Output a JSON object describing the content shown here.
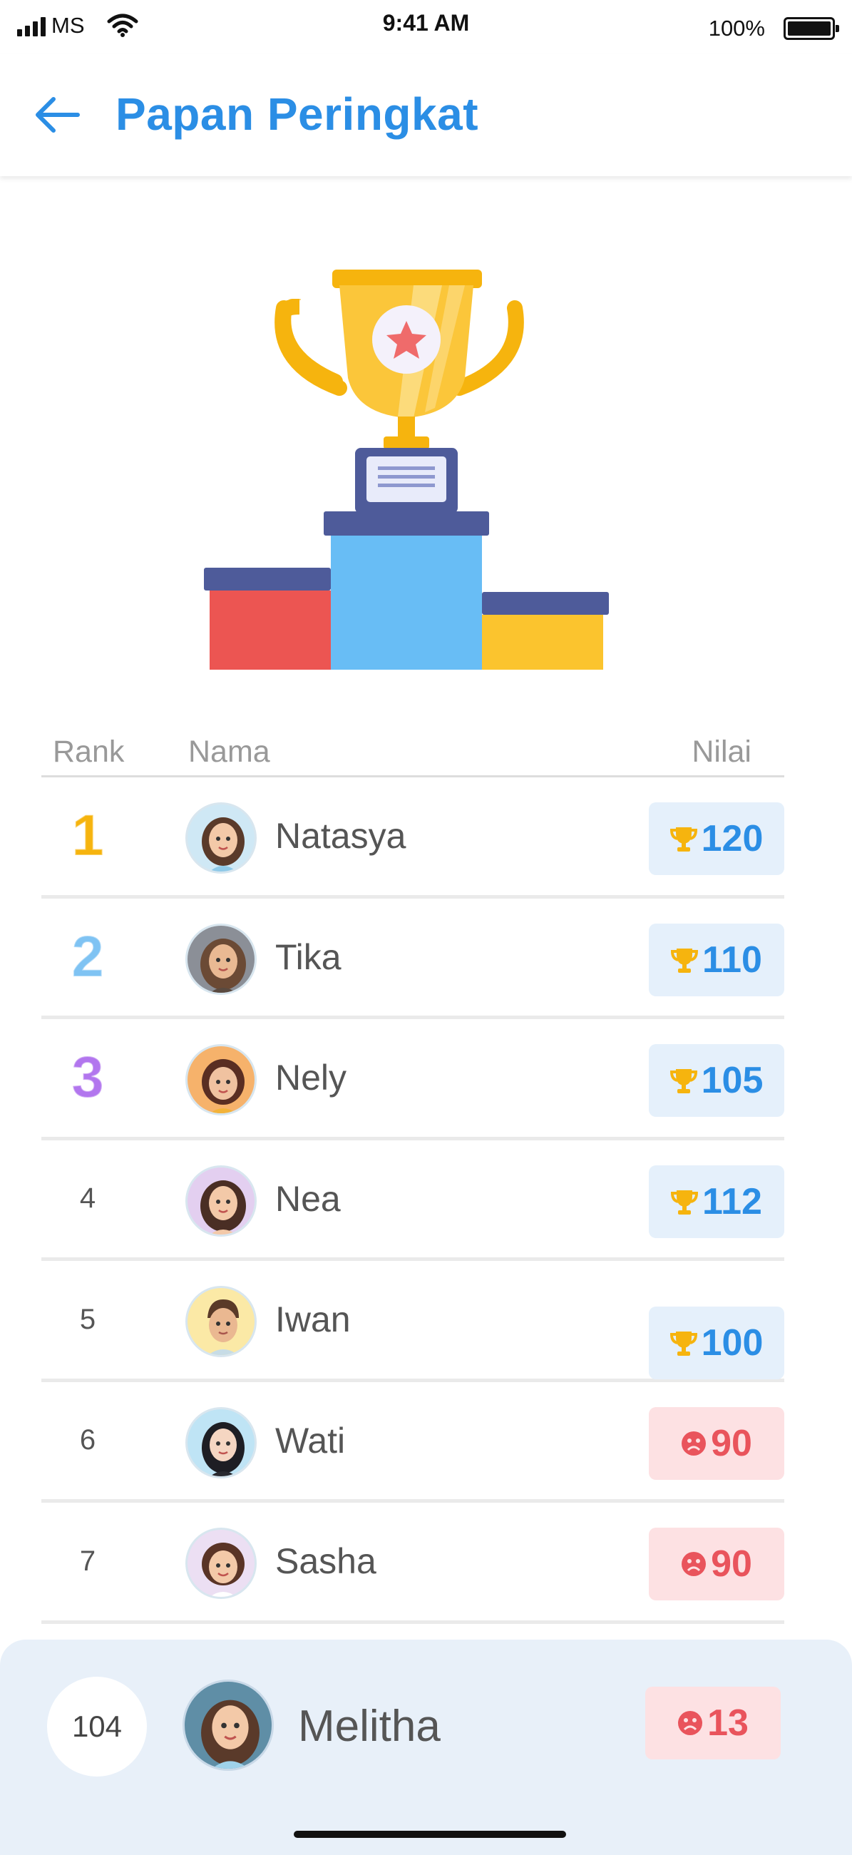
{
  "status_bar": {
    "carrier": "MS",
    "time": "9:41 AM",
    "battery": "100%"
  },
  "header": {
    "title": "Papan Peringkat"
  },
  "colors": {
    "accent": "#2b8ee5",
    "gold": "#f6b40e",
    "silver": "#7fc3f3",
    "bronze": "#b276ee",
    "good_score_bg": "#e5f0fb",
    "bad_score_bg": "#fde1e3",
    "bad_score_text": "#e9545c"
  },
  "table": {
    "columns": {
      "rank": "Rank",
      "name": "Nama",
      "score": "Nilai"
    },
    "rows": [
      {
        "rank": "1",
        "name": "Natasya",
        "score": "120",
        "icon": "trophy-icon"
      },
      {
        "rank": "2",
        "name": "Tika",
        "score": "110",
        "icon": "trophy-icon"
      },
      {
        "rank": "3",
        "name": "Nely",
        "score": "105",
        "icon": "trophy-icon"
      },
      {
        "rank": "4",
        "name": "Nea",
        "score": "112",
        "icon": "trophy-icon"
      },
      {
        "rank": "5",
        "name": "Iwan",
        "score": "100",
        "icon": "trophy-icon"
      },
      {
        "rank": "6",
        "name": "Wati",
        "score": "90",
        "icon": "sad-face-icon"
      },
      {
        "rank": "7",
        "name": "Sasha",
        "score": "90",
        "icon": "sad-face-icon"
      }
    ]
  },
  "current_user": {
    "rank": "104",
    "name": "Melitha",
    "score": "13",
    "icon": "sad-face-icon"
  }
}
